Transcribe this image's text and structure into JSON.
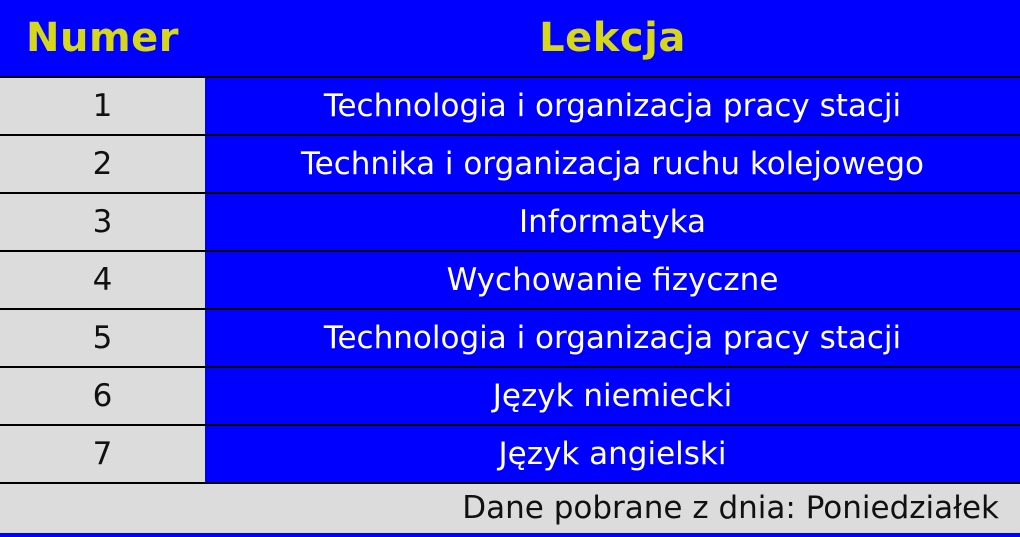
{
  "table": {
    "headers": {
      "number": "Numer",
      "lesson": "Lekcja"
    },
    "rows": [
      {
        "number": "1",
        "lesson": "Technologia i organizacja pracy stacji"
      },
      {
        "number": "2",
        "lesson": "Technika i organizacja ruchu kolejowego"
      },
      {
        "number": "3",
        "lesson": "Informatyka"
      },
      {
        "number": "4",
        "lesson": "Wychowanie fizyczne"
      },
      {
        "number": "5",
        "lesson": "Technologia i organizacja pracy stacji"
      },
      {
        "number": "6",
        "lesson": "Język niemiecki"
      },
      {
        "number": "7",
        "lesson": "Język angielski"
      }
    ]
  },
  "footer": {
    "text": "Dane pobrane z dnia: Poniedziałek"
  },
  "colors": {
    "header_background": "#0000ff",
    "header_text": "#d6d61a",
    "lesson_background": "#0000ff",
    "lesson_text": "#ffffff",
    "number_background": "#dcdcdc",
    "number_text": "#111111"
  }
}
